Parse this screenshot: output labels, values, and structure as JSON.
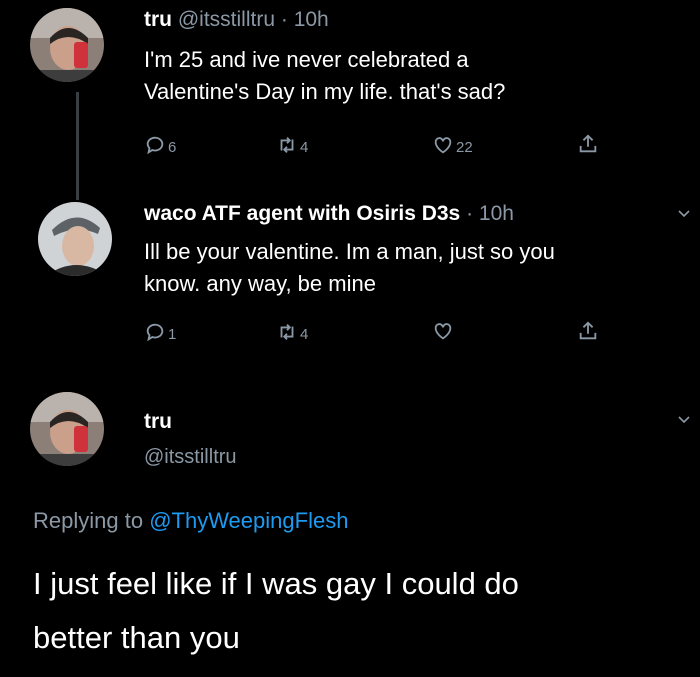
{
  "tweet1": {
    "name": "tru",
    "handle": "@itsstilltru",
    "dot": "·",
    "time": "10h",
    "text_line1": "I'm 25 and ive never celebrated a",
    "text_line2": "Valentine's Day in my life. that's sad?",
    "replies": "6",
    "retweets": "4",
    "likes": "22",
    "icons": [
      "reply-icon",
      "retweet-icon",
      "heart-icon",
      "share-icon"
    ]
  },
  "tweet2": {
    "name": "waco ATF agent with Osiris D3s",
    "dot": "·",
    "time": "10h",
    "text_line1": "Ill be your valentine. Im a man, just so you",
    "text_line2": "know. any way, be mine",
    "replies": "1",
    "retweets": "4",
    "icons": [
      "reply-icon",
      "retweet-icon",
      "heart-icon",
      "share-icon",
      "chevron-down-icon"
    ]
  },
  "tweet3": {
    "name": "tru",
    "handle": "@itsstilltru",
    "replying_prefix": "Replying to ",
    "replying_to": "@ThyWeepingFlesh",
    "text_line1": "I just feel like if I was gay I could do",
    "text_line2": "better than you"
  },
  "colors": {
    "background": "#000000",
    "text": "#ffffff",
    "secondary": "#8b98a5",
    "mention": "#1d9bf0",
    "thread_line": "#3a3f44"
  }
}
